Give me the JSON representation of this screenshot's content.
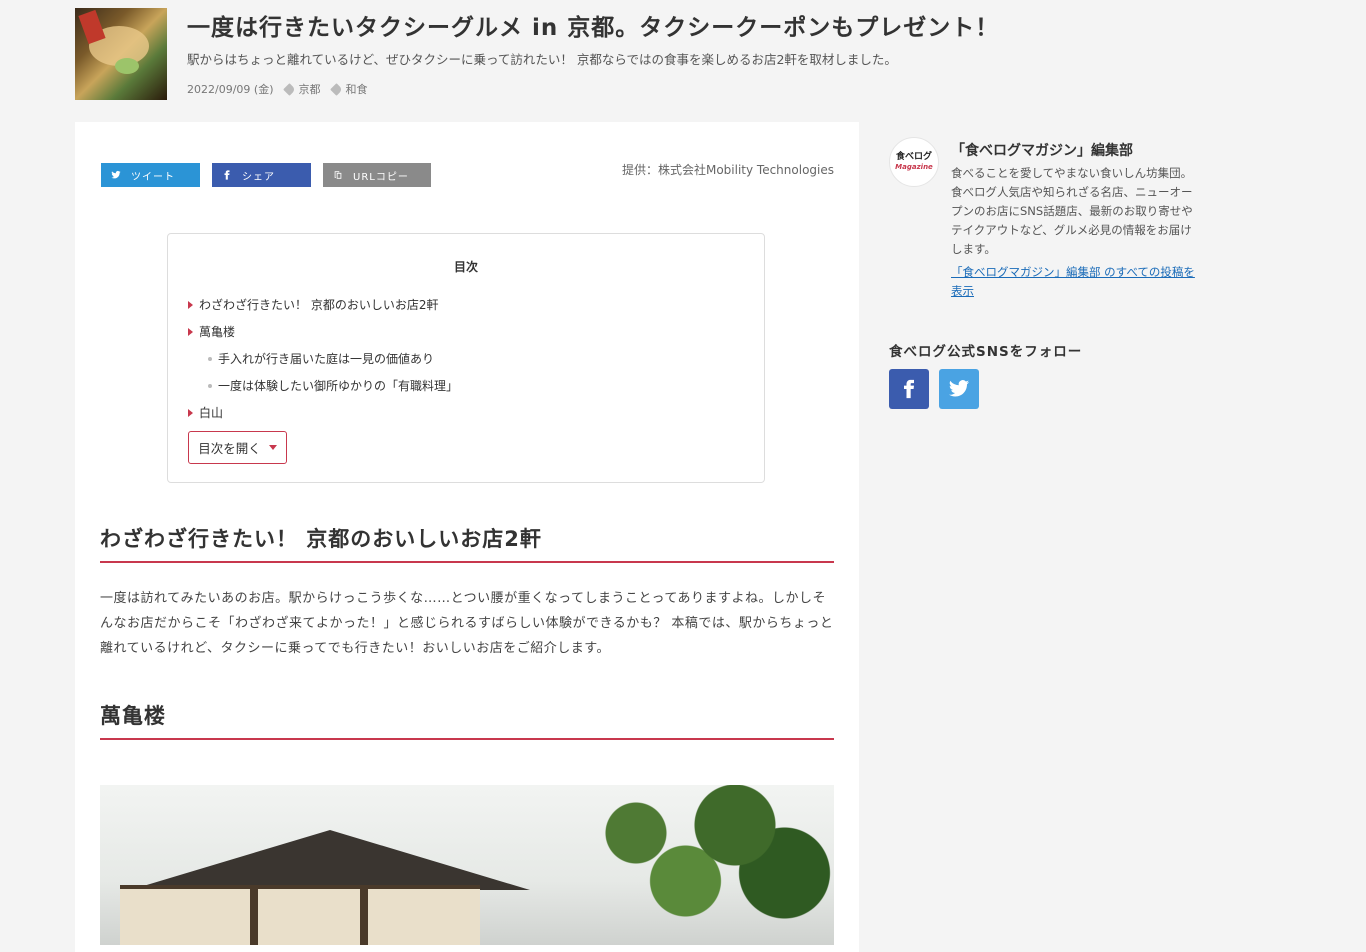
{
  "article": {
    "title": "一度は行きたいタクシーグルメ in 京都。タクシークーポンもプレゼント！",
    "subtitle": "駅からはちょっと離れているけど、ぜひタクシーに乗って訪れたい！ 京都ならではの食事を楽しめるお店2軒を取材しました。",
    "date": "2022/09/09 (金)",
    "tags": [
      "京都",
      "和食"
    ],
    "provider": "提供：株式会社Mobility Technologies"
  },
  "share": {
    "tweet": "ツイート",
    "facebook": "シェア",
    "url_copy": "URLコピー"
  },
  "toc": {
    "title": "目次",
    "items": [
      {
        "label": "わざわざ行きたい！ 京都のおいしいお店2軒",
        "level": 1
      },
      {
        "label": "萬亀楼",
        "level": 1
      },
      {
        "label": "手入れが行き届いた庭は一見の価値あり",
        "level": 2
      },
      {
        "label": "一度は体験したい御所ゆかりの「有職料理」",
        "level": 2
      },
      {
        "label": "白山",
        "level": 1
      }
    ],
    "toggle_label": "目次を開く"
  },
  "sections": {
    "heading1": "わざわざ行きたい！ 京都のおいしいお店2軒",
    "paragraph1": "一度は訪れてみたいあのお店。駅からけっこう歩くな……とつい腰が重くなってしまうことってありますよね。しかしそんなお店だからこそ「わざわざ来てよかった！」と感じられるすばらしい体験ができるかも？ 本稿では、駅からちょっと離れているけれど、タクシーに乗ってでも行きたい！おいしいお店をご紹介します。",
    "heading2": "萬亀楼"
  },
  "sidebar": {
    "avatar_text": "食べログ",
    "avatar_sub": "Magazine",
    "author_name": "「食べログマガジン」編集部",
    "author_desc": "食べることを愛してやまない食いしん坊集団。食べログ人気店や知られざる名店、ニューオープンのお店にSNS話題店、最新のお取り寄せやテイクアウトなど、グルメ必見の情報をお届けします。",
    "author_link": "「食べログマガジン」編集部 のすべての投稿を表示",
    "sns_title": "食べログ公式SNSをフォロー"
  },
  "colors": {
    "accent": "#c8384d",
    "twitter": "#2b94d6",
    "facebook": "#3b5cae",
    "link": "#1a6bb8"
  }
}
